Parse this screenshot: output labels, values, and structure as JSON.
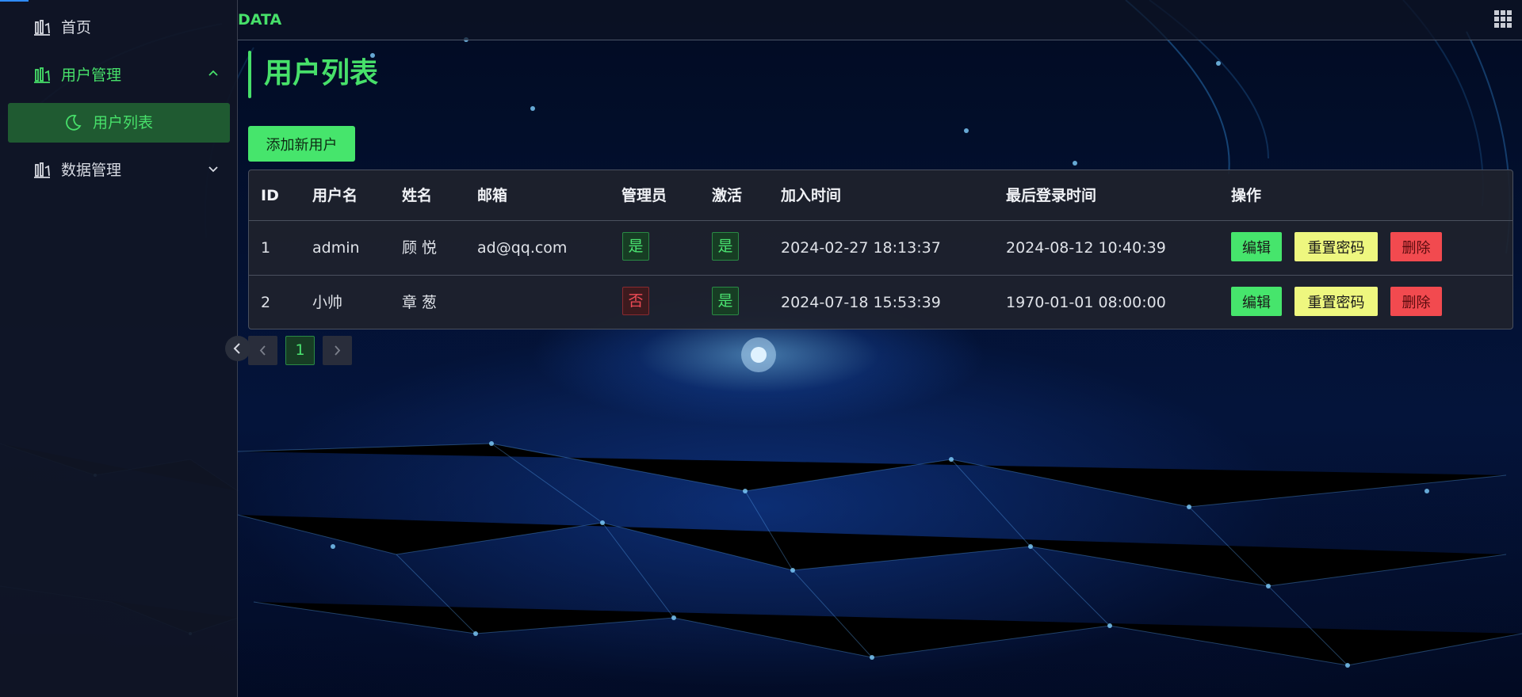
{
  "app": {
    "brand": "DATA"
  },
  "sidebar": {
    "items": [
      {
        "label": "首页",
        "icon": "bar-chart-icon"
      },
      {
        "label": "用户管理",
        "icon": "bar-chart-icon",
        "expanded": true,
        "children": [
          {
            "label": "用户列表",
            "icon": "moon-icon",
            "active": true
          }
        ]
      },
      {
        "label": "数据管理",
        "icon": "bar-chart-icon",
        "expanded": false
      }
    ]
  },
  "main": {
    "title": "用户列表",
    "add_button": "添加新用户",
    "table": {
      "columns": [
        "ID",
        "用户名",
        "姓名",
        "邮箱",
        "管理员",
        "激活",
        "加入时间",
        "最后登录时间",
        "操作"
      ],
      "rows": [
        {
          "id": "1",
          "username": "admin",
          "name": "顾 悦",
          "email": "ad@qq.com",
          "admin": "是",
          "active": "是",
          "joined": "2024-02-27 18:13:37",
          "last_login": "2024-08-12 10:40:39"
        },
        {
          "id": "2",
          "username": "小帅",
          "name": "章 葱",
          "email": "",
          "admin": "否",
          "active": "是",
          "joined": "2024-07-18 15:53:39",
          "last_login": "1970-01-01 08:00:00"
        }
      ],
      "actions": {
        "edit": "编辑",
        "reset": "重置密码",
        "delete": "删除"
      }
    },
    "pagination": {
      "current_page": "1"
    }
  },
  "colors": {
    "accent": "#47e06a",
    "danger": "#f24a4f",
    "warning": "#eef77f",
    "sidebar_bg": "#101626"
  }
}
